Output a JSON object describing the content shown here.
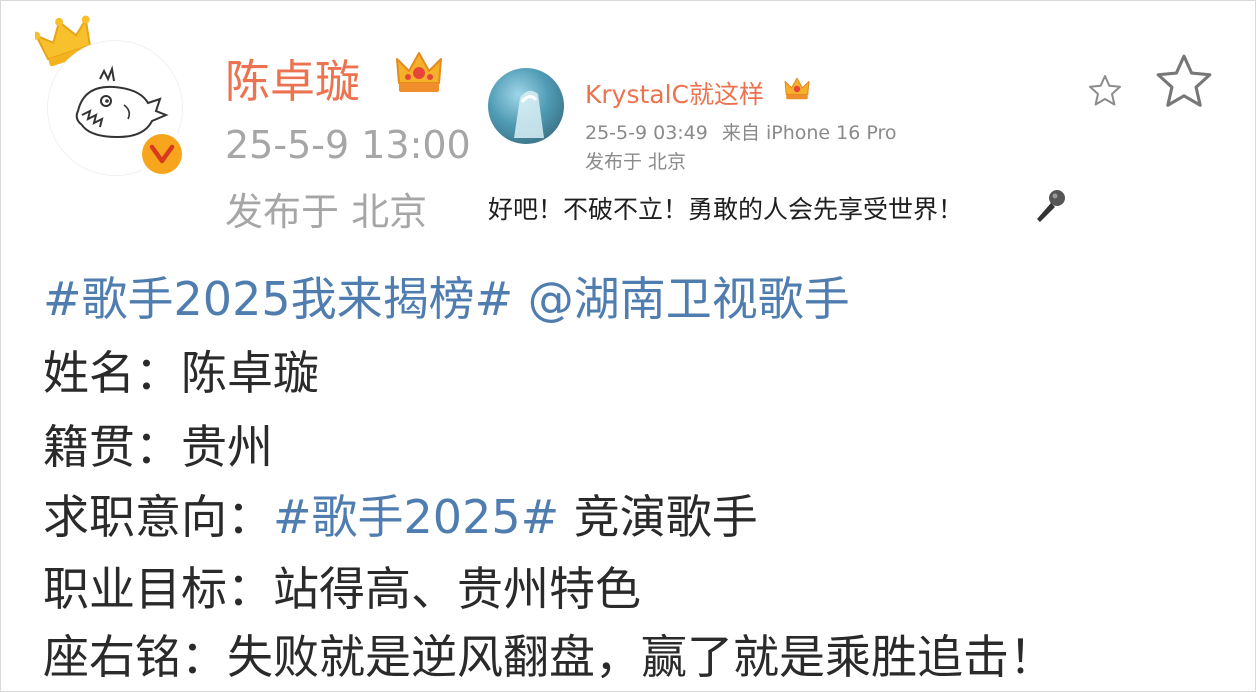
{
  "post": {
    "author": "陈卓璇",
    "time": "25-5-9 13:00",
    "location": "发布于 北京",
    "avatar_icon": "cartoon-bird-avatar",
    "verified_icon": "verified-v-badge",
    "member_icon": "crown-icon"
  },
  "repost": {
    "author": "KrystalC就这样",
    "time": "25-5-9 03:49",
    "source": "来自 iPhone 16 Pro",
    "location": "发布于 北京",
    "text": "好吧！不破不立！勇敢的人会先享受世界！",
    "emoji": "🎤"
  },
  "actions": {
    "favorite_small_icon": "star-outline-icon",
    "favorite_icon": "star-outline-icon"
  },
  "content": {
    "topic": "#歌手2025我来揭榜#",
    "mention": "@湖南卫视歌手",
    "name_label": "姓名：",
    "name_value": "陈卓璇",
    "origin_label": "籍贯：",
    "origin_value": "贵州",
    "intent_label": "求职意向：",
    "intent_topic": "#歌手2025#",
    "intent_value": "竞演歌手",
    "goal_label": "职业目标：",
    "goal_value": "站得高、贵州特色",
    "motto_label": "座右铭：",
    "motto_value": "失败就是逆风翻盘，赢了就是乘胜追击！"
  },
  "colors": {
    "name": "#eb7350",
    "topic": "#507daf",
    "meta": "#a6a6a6",
    "text": "#2a2a2a"
  }
}
